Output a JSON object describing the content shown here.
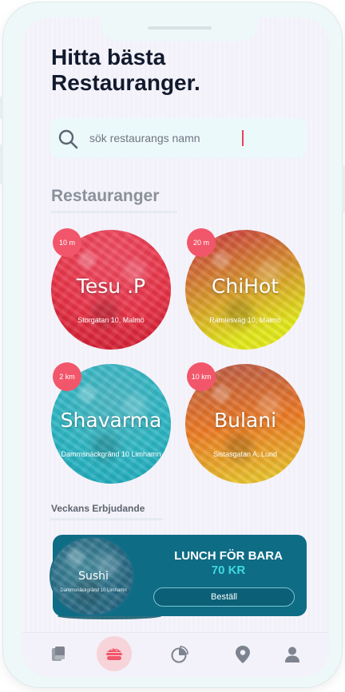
{
  "header": {
    "title_line1": "Hitta bästa",
    "title_line2": "Restauranger."
  },
  "search": {
    "placeholder": "sök restaurangs namn",
    "icon": "search-icon"
  },
  "restaurants_section": {
    "title": "Restauranger"
  },
  "restaurants": [
    {
      "name": "Tesu .P",
      "address": "Storgatan 10, Malmö",
      "distance": "10 m",
      "gradient": [
        "#f03a4f",
        "#d4182c"
      ]
    },
    {
      "name": "ChiHot",
      "address": "Ramlesväg 10, Malmö",
      "distance": "20 m",
      "gradient": [
        "#e1e817",
        "#dc3a3a"
      ]
    },
    {
      "name": "Shavarma",
      "address": "Dammsnäckgränd 10 Limhamn",
      "distance": "2 km",
      "gradient": [
        "#2bc3cc",
        "#1aa7b8"
      ]
    },
    {
      "name": "Bulani",
      "address": "Sistasgatan A, Lund",
      "distance": "10 km",
      "gradient": [
        "#ef7a22",
        "#e6c02a"
      ]
    }
  ],
  "offers": {
    "title": "Veckans Erbjudande",
    "card": {
      "restaurant_name": "Sushi",
      "address": "Dammsnäckgränd 10 Limhamn",
      "headline": "LUNCH FÖR BARA",
      "price": "70 KR",
      "button_label": "Beställ"
    }
  },
  "tabbar": {
    "items": [
      "menu-book-icon",
      "burger-icon",
      "pie-chart-icon",
      "location-pin-icon",
      "profile-icon"
    ],
    "active": "burger-icon"
  },
  "colors": {
    "accent": "#f2566a",
    "promo": "#0e6c85",
    "price": "#3fd9e3",
    "title": "#121a2e"
  }
}
